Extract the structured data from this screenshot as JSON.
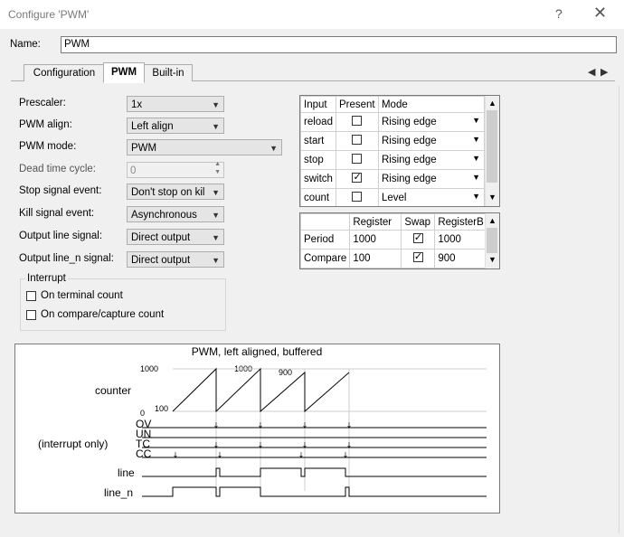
{
  "window": {
    "title": "Configure 'PWM'",
    "help_glyph": "?",
    "close_glyph": "✕"
  },
  "name_field": {
    "label": "Name:",
    "value": "PWM"
  },
  "tabs": [
    {
      "label": "Configuration"
    },
    {
      "label": "PWM"
    },
    {
      "label": "Built-in"
    }
  ],
  "tab_nav": {
    "prev": "◀",
    "next": "▶"
  },
  "form": {
    "prescaler": {
      "label": "Prescaler:",
      "value": "1x"
    },
    "pwm_align": {
      "label": "PWM align:",
      "value": "Left align"
    },
    "pwm_mode": {
      "label": "PWM mode:",
      "value": "PWM"
    },
    "dead_time": {
      "label": "Dead time cycle:",
      "value": "0"
    },
    "stop_signal": {
      "label": "Stop signal event:",
      "value": "Don't stop on kil"
    },
    "kill_signal": {
      "label": "Kill signal event:",
      "value": "Asynchronous"
    },
    "output_line": {
      "label": "Output line signal:",
      "value": "Direct output"
    },
    "output_line_n": {
      "label": "Output line_n signal:",
      "value": "Direct output"
    }
  },
  "interrupt": {
    "title": "Interrupt",
    "on_terminal_count": {
      "label": "On terminal count",
      "checked": false
    },
    "on_compare_capture": {
      "label": "On compare/capture count",
      "checked": false
    }
  },
  "inputs_table": {
    "headers": [
      "Input",
      "Present",
      "Mode"
    ],
    "rows": [
      {
        "input": "reload",
        "present": false,
        "mode": "Rising edge"
      },
      {
        "input": "start",
        "present": false,
        "mode": "Rising edge"
      },
      {
        "input": "stop",
        "present": false,
        "mode": "Rising edge"
      },
      {
        "input": "switch",
        "present": true,
        "mode": "Rising edge"
      },
      {
        "input": "count",
        "present": false,
        "mode": "Level"
      }
    ]
  },
  "registers_table": {
    "headers": [
      "",
      "Register",
      "Swap",
      "RegisterB"
    ],
    "rows": [
      {
        "name": "Period",
        "register": "1000",
        "swap": true,
        "register_b": "1000"
      },
      {
        "name": "Compare",
        "register": "100",
        "swap": true,
        "register_b": "900"
      }
    ]
  },
  "waveform": {
    "title": "PWM, left aligned, buffered",
    "counter_label": "counter",
    "labels": {
      "ov": "OV",
      "un": "UN",
      "tc": "TC",
      "cc": "CC",
      "interrupt_only": "(interrupt only)",
      "line": "line",
      "line_n": "line_n"
    },
    "annotations": {
      "v1000_axis": "1000",
      "v0_axis": "0",
      "v100": "100",
      "v1000_peak": "1000",
      "v900": "900"
    }
  }
}
